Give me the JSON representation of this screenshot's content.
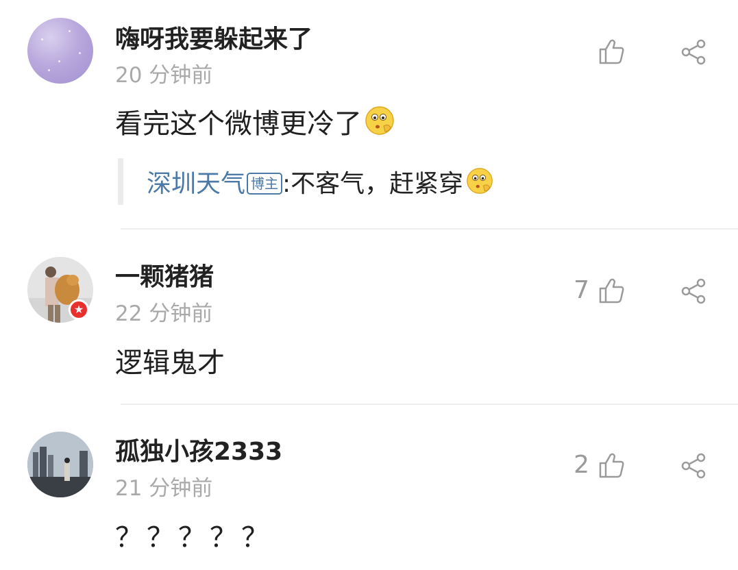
{
  "comments": [
    {
      "username": "嗨呀我要躲起来了",
      "time": "20 分钟前",
      "content": "看完这个微博更冷了",
      "likes": "",
      "emoji": "cold-emoji",
      "reply": {
        "author": "深圳天气",
        "tag": "博主",
        "text": ":不客气，赶紧穿",
        "emoji": "cold-emoji"
      },
      "avatar": "purple-galaxy-avatar"
    },
    {
      "username": "一颗猪猪",
      "time": "22 分钟前",
      "content": "逻辑鬼才",
      "likes": "7",
      "badge": "★",
      "avatar": "person-with-cat-avatar"
    },
    {
      "username": "孤独小孩2333",
      "time": "21 分钟前",
      "content": "？？？？？",
      "likes": "2",
      "avatar": "city-figure-avatar"
    }
  ],
  "icons": {
    "like": "thumbs-up-icon",
    "share": "share-icon"
  },
  "colors": {
    "username": "#222222",
    "time": "#a9a9a9",
    "link": "#4d79a6",
    "badge": "#e8312f",
    "icon": "#9a9a9a"
  }
}
